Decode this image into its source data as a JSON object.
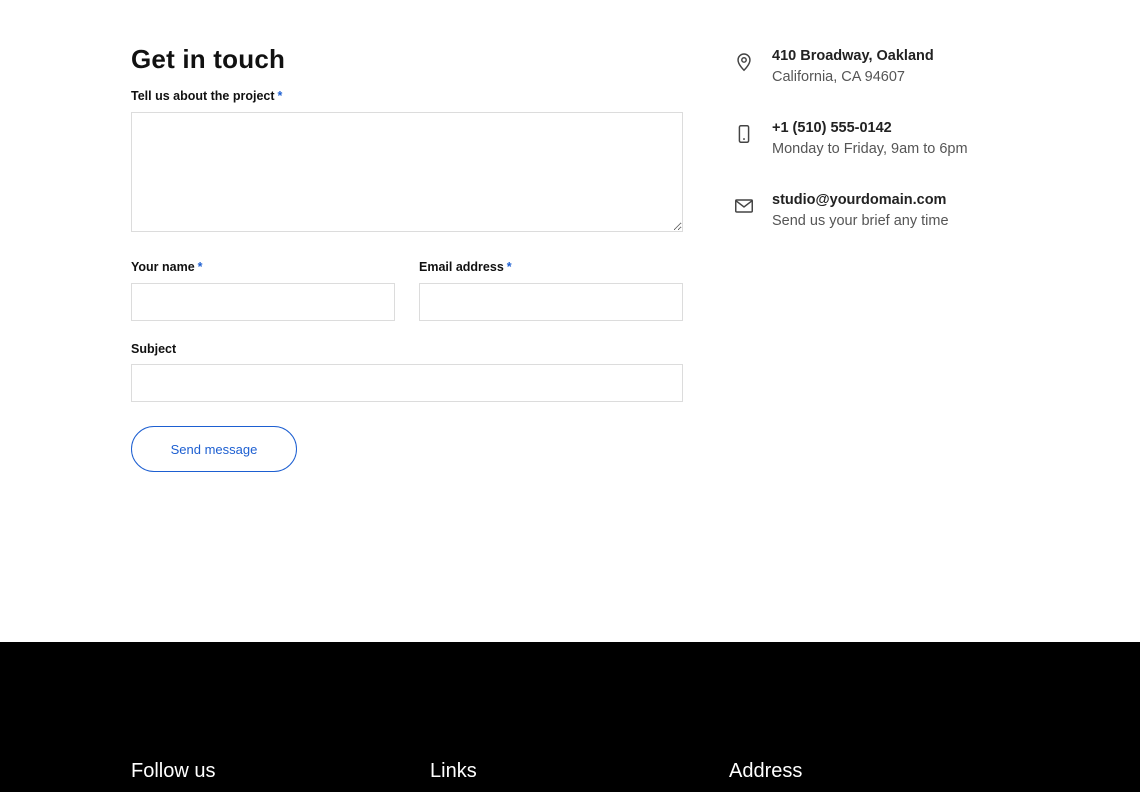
{
  "form": {
    "title": "Get in touch",
    "required_mark": "*",
    "project_label": "Tell us about the project",
    "name_label": "Your name",
    "email_label": "Email address",
    "subject_label": "Subject",
    "submit_label": "Send message",
    "project_value": "",
    "name_value": "",
    "email_value": "",
    "subject_value": ""
  },
  "contact": {
    "address": {
      "icon": "location-pin-icon",
      "line1": "410 Broadway, Oakland",
      "line2": "California, CA 94607"
    },
    "phone": {
      "icon": "smartphone-icon",
      "line1": "+1 (510) 555-0142",
      "line2": "Monday to Friday, 9am to 6pm"
    },
    "email": {
      "icon": "envelope-icon",
      "line1": "studio@yourdomain.com",
      "line2": "Send us your brief any time"
    }
  },
  "footer": {
    "follow_heading": "Follow us",
    "links_heading": "Links",
    "address_heading": "Address"
  },
  "colors": {
    "accent": "#1d5fd1",
    "footer_bg": "#000000",
    "border": "#dcdcdc"
  }
}
